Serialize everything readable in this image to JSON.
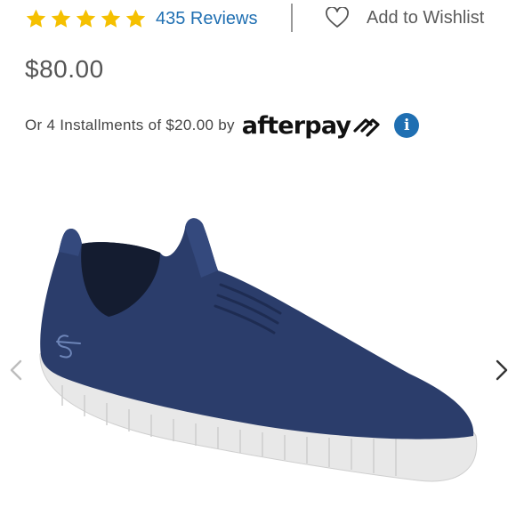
{
  "rating": {
    "stars": 5,
    "star_color": "#f5c000",
    "reviews_label": "435 Reviews",
    "reviews_color": "#1f6fb2"
  },
  "wishlist": {
    "icon": "heart-outline-icon",
    "label": "Add to Wishlist"
  },
  "price": "$80.00",
  "installments": {
    "text": "Or 4 Installments of $20.00 by",
    "provider": "afterpay",
    "provider_icon": "afterpay-logo-icon",
    "info_icon_glyph": "i",
    "info_icon_color": "#1f6fb2"
  },
  "gallery": {
    "image": "navy-slip-on-sneaker-image",
    "product_color": "#2b3d6b",
    "sole_color": "#e8e8e8",
    "prev_icon": "chevron-left-icon",
    "next_icon": "chevron-right-icon"
  }
}
